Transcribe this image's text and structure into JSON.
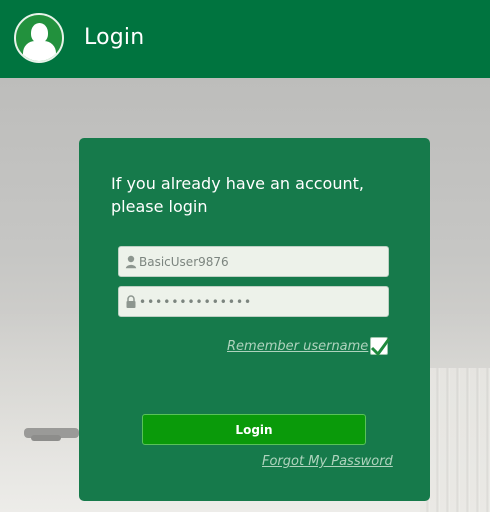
{
  "header": {
    "title": "Login",
    "icon": "user-avatar-icon"
  },
  "login_card": {
    "prompt": "If you already have an account, please login",
    "username": {
      "value": "BasicUser9876",
      "icon": "user-icon"
    },
    "password": {
      "value": "••••••••••••••",
      "icon": "lock-icon"
    },
    "remember_label": "Remember username",
    "remember_checked": true,
    "login_button_label": "Login",
    "forgot_link": "Forgot My Password"
  },
  "colors": {
    "header_bg": "#00743f",
    "card_bg": "#167a4b",
    "button_bg": "#0a9a0a",
    "link": "#aed3bd"
  }
}
